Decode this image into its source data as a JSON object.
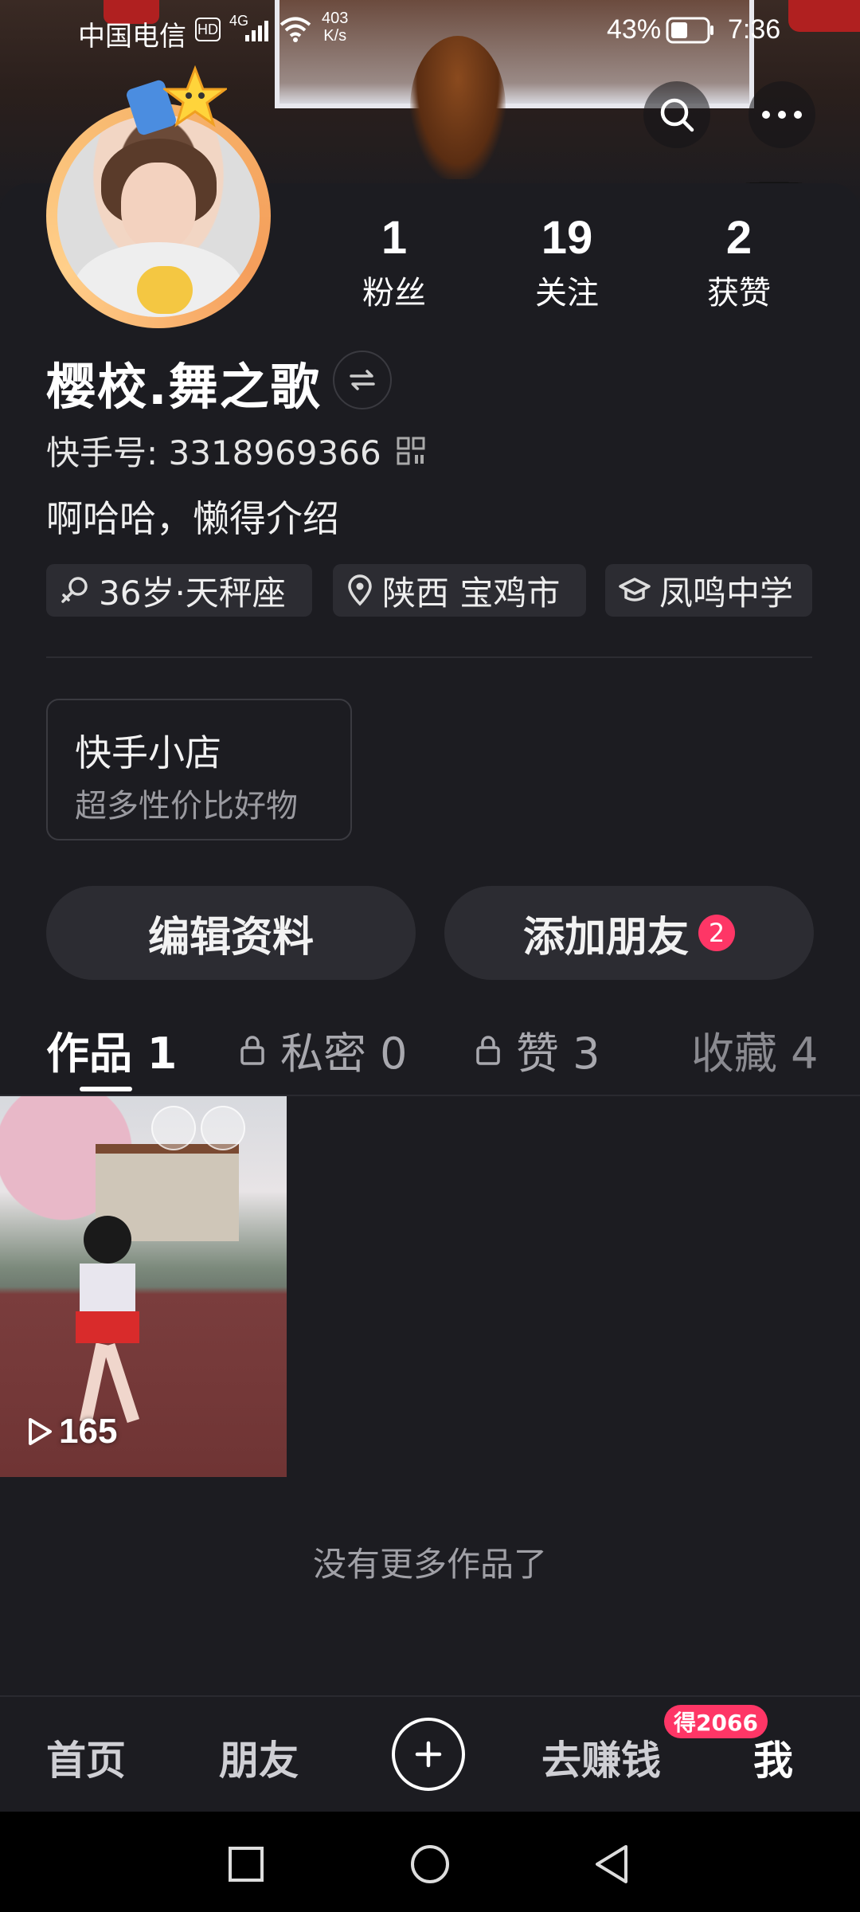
{
  "status_bar": {
    "carrier": "中国电信",
    "hd": "HD",
    "network": "4G",
    "speed_value": "403",
    "speed_unit": "K/s",
    "battery": "43%",
    "time": "7:36"
  },
  "profile": {
    "stats": [
      {
        "value": "1",
        "label": "粉丝"
      },
      {
        "value": "19",
        "label": "关注"
      },
      {
        "value": "2",
        "label": "获赞"
      }
    ],
    "name": "樱校.舞之歌",
    "id_line": "快手号: 3318969366",
    "bio": "啊哈哈，懒得介绍",
    "tags": {
      "age": "36岁·天秤座",
      "location": "陕西 宝鸡市",
      "school": "凤鸣中学"
    }
  },
  "shop": {
    "title": "快手小店",
    "subtitle": "超多性价比好物"
  },
  "actions": {
    "edit": "编辑资料",
    "add_friend": "添加朋友",
    "add_friend_badge": "2"
  },
  "tabs": {
    "works": "作品 1",
    "private": "私密 0",
    "liked": "赞 3",
    "favorites": "收藏 4"
  },
  "work_item": {
    "play_count": "165"
  },
  "no_more_text": "没有更多作品了",
  "bottom_nav": {
    "home": "首页",
    "friends": "朋友",
    "earn": "去赚钱",
    "earn_badge": "得2066",
    "me": "我"
  },
  "colors": {
    "background": "#1c1c21",
    "badge_red": "#fe3666",
    "button_bg": "#2c2c32"
  }
}
